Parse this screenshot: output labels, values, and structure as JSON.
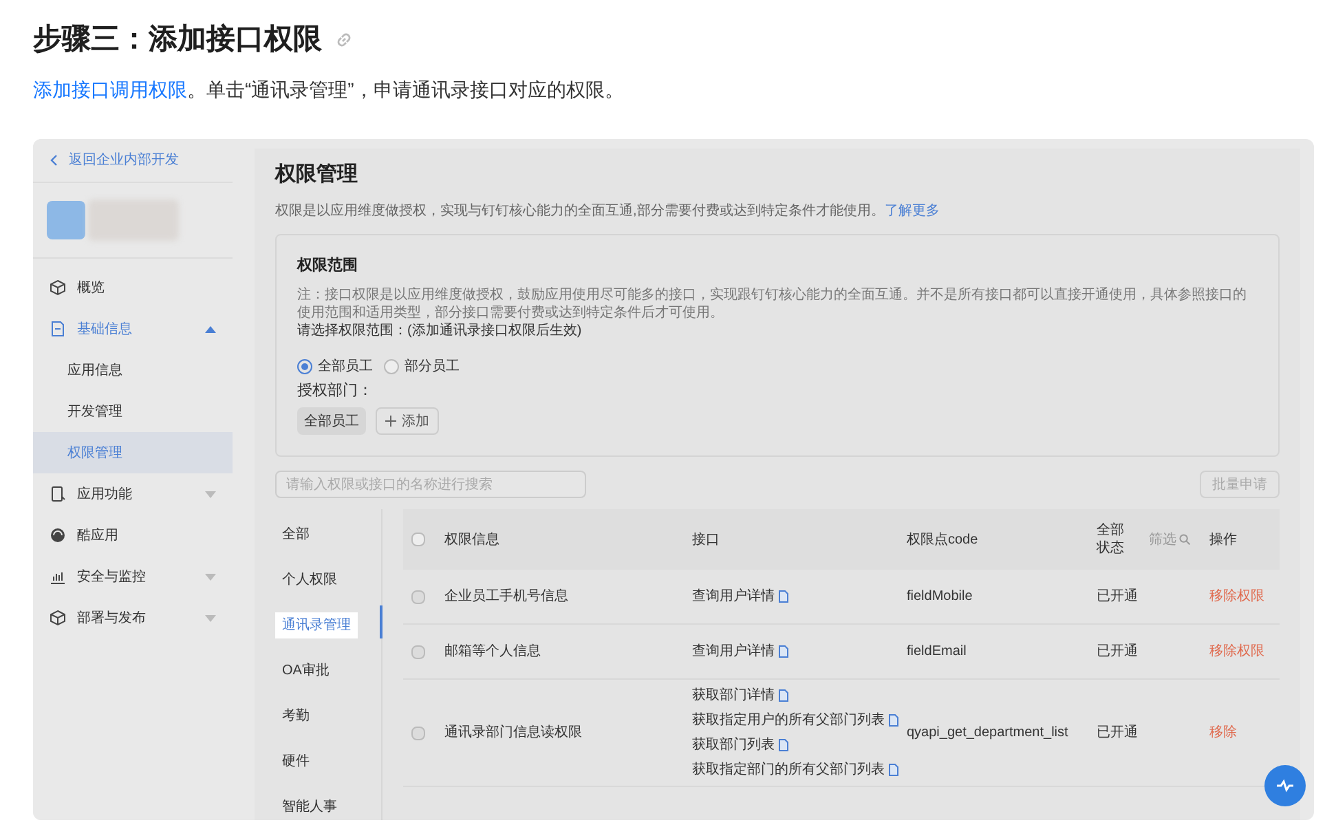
{
  "heading": "步骤三：添加接口权限",
  "intro": {
    "link": "添加接口调用权限",
    "text": "。单击“通讯录管理”，申请通讯录接口对应的权限。"
  },
  "sidebar": {
    "back": "返回企业内部开发",
    "items": [
      {
        "label": "概览",
        "selected": false
      },
      {
        "label": "基础信息",
        "selected": false,
        "expanded": true,
        "children": [
          {
            "label": "应用信息",
            "selected": false
          },
          {
            "label": "开发管理",
            "selected": false
          },
          {
            "label": "权限管理",
            "selected": true
          }
        ]
      },
      {
        "label": "应用功能",
        "selected": false,
        "expanded": false
      },
      {
        "label": "酷应用",
        "selected": false
      },
      {
        "label": "安全与监控",
        "selected": false,
        "expanded": false
      },
      {
        "label": "部署与发布",
        "selected": false,
        "expanded": false
      }
    ]
  },
  "page": {
    "title": "权限管理",
    "description": "权限是以应用维度做授权，实现与钉钉核心能力的全面互通,部分需要付费或达到特定条件才能使用。",
    "more_link": "了解更多"
  },
  "scope": {
    "title": "权限范围",
    "note": "注：接口权限是以应用维度做授权，鼓励应用使用尽可能多的接口，实现跟钉钉核心能力的全面互通。并不是所有接口都可以直接开通使用，具体参照接口的使用范围和适用类型，部分接口需要付费或达到特定条件后才可使用。",
    "prompt": "请选择权限范围：(添加通讯录接口权限后生效)",
    "options": [
      {
        "label": "全部员工",
        "selected": true
      },
      {
        "label": "部分员工",
        "selected": false
      }
    ],
    "dept_label": "授权部门：",
    "dept_tag": "全部员工",
    "add_button": "添加"
  },
  "search": {
    "placeholder": "请输入权限或接口的名称进行搜索"
  },
  "batch_button": "批量申请",
  "categories": [
    {
      "label": "全部",
      "selected": false
    },
    {
      "label": "个人权限",
      "selected": false
    },
    {
      "label": "通讯录管理",
      "selected": true
    },
    {
      "label": "OA审批",
      "selected": false
    },
    {
      "label": "考勤",
      "selected": false
    },
    {
      "label": "硬件",
      "selected": false
    },
    {
      "label": "智能人事",
      "selected": false
    }
  ],
  "table": {
    "columns": [
      "权限信息",
      "接口",
      "权限点code",
      "全部状态",
      "操作"
    ],
    "filter": "筛选",
    "rows": [
      {
        "checked": false,
        "name": "企业员工手机号信息",
        "apis": [
          "查询用户详情"
        ],
        "code": "fieldMobile",
        "status": "已开通",
        "action": "移除权限"
      },
      {
        "checked": false,
        "name": "邮箱等个人信息",
        "apis": [
          "查询用户详情"
        ],
        "code": "fieldEmail",
        "status": "已开通",
        "action": "移除权限"
      },
      {
        "checked": false,
        "name": "通讯录部门信息读权限",
        "apis": [
          "获取部门详情",
          "获取指定用户的所有父部门列表",
          "获取部门列表",
          "获取指定部门的所有父部门列表"
        ],
        "code": "qyapi_get_department_list",
        "status": "已开通",
        "action": "移除"
      }
    ],
    "select_all": false
  }
}
